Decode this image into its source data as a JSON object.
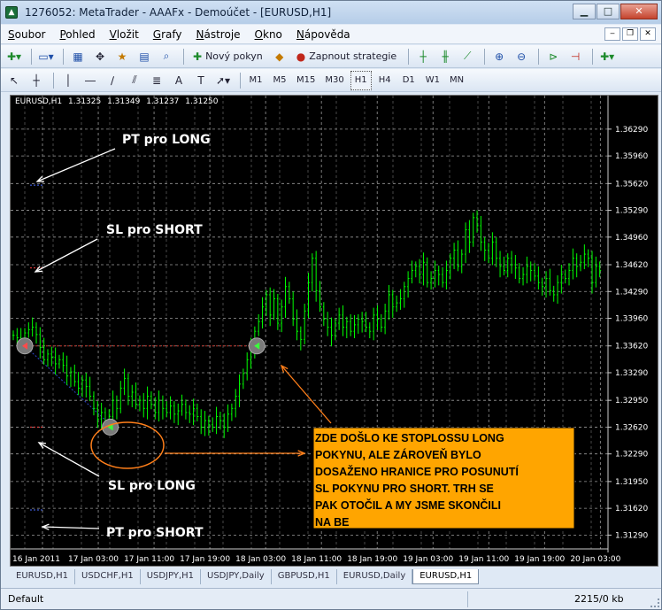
{
  "window": {
    "title": "1276052: MetaTrader - AAAFx - Demoúčet - [EURUSD,H1]",
    "minimize": "▁",
    "maximize": "□",
    "close": "✕"
  },
  "menu": {
    "items": [
      {
        "first": "S",
        "rest": "oubor"
      },
      {
        "first": "P",
        "rest": "ohled"
      },
      {
        "first": "V",
        "rest": "ložit"
      },
      {
        "first": "G",
        "rest": "rafy"
      },
      {
        "first": "N",
        "rest": "ástroje"
      },
      {
        "first": "O",
        "rest": "kno"
      },
      {
        "first": "N",
        "rest": "ápověda"
      }
    ],
    "mdi": {
      "minimize": "‒",
      "restore": "❐",
      "close": "✕"
    }
  },
  "toolbar1": {
    "new_order": "Nový pokyn",
    "strategies": "Zapnout strategie"
  },
  "toolbar2": {
    "periods": [
      "M1",
      "M5",
      "M15",
      "M30",
      "H1",
      "H4",
      "D1",
      "W1",
      "MN"
    ],
    "active_period": "H1"
  },
  "chart_data": {
    "type": "candlestick",
    "symbol_info": {
      "symbol": "EURUSD,H1",
      "open": "1.31325",
      "high": "1.31349",
      "low": "1.31237",
      "close": "1.31250"
    },
    "y_ticks": [
      "1.36290",
      "1.35960",
      "1.35620",
      "1.35290",
      "1.34960",
      "1.34620",
      "1.34290",
      "1.33960",
      "1.33620",
      "1.33290",
      "1.32950",
      "1.32620",
      "1.32290",
      "1.31950",
      "1.31620",
      "1.31290"
    ],
    "x_ticks": [
      "16 Jan 2011",
      "17 Jan 03:00",
      "17 Jan 11:00",
      "17 Jan 19:00",
      "18 Jan 03:00",
      "18 Jan 11:00",
      "18 Jan 19:00",
      "19 Jan 03:00",
      "19 Jan 11:00",
      "19 Jan 19:00",
      "20 Jan 03:00"
    ],
    "ylim": [
      1.3112,
      1.3655
    ],
    "series_close": [
      1.3375,
      1.3372,
      1.3368,
      1.3378,
      1.3382,
      1.3385,
      1.3376,
      1.336,
      1.3345,
      1.3352,
      1.3348,
      1.334,
      1.3345,
      1.3338,
      1.3325,
      1.333,
      1.3318,
      1.331,
      1.332,
      1.3312,
      1.33,
      1.3285,
      1.3272,
      1.328,
      1.3262,
      1.3275,
      1.3295,
      1.3285,
      1.331,
      1.3322,
      1.33,
      1.3305,
      1.329,
      1.3295,
      1.3285,
      1.33,
      1.329,
      1.328,
      1.3295,
      1.3285,
      1.328,
      1.3288,
      1.3278,
      1.3282,
      1.329,
      1.328,
      1.3278,
      1.3285,
      1.3275,
      1.3262,
      1.327,
      1.3265,
      1.3262,
      1.3275,
      1.327,
      1.3262,
      1.3278,
      1.3285,
      1.33,
      1.3315,
      1.3328,
      1.3345,
      1.336,
      1.338,
      1.3392,
      1.341,
      1.3425,
      1.34,
      1.342,
      1.339,
      1.341,
      1.3435,
      1.342,
      1.3395,
      1.338,
      1.337,
      1.3405,
      1.344,
      1.347,
      1.343,
      1.341,
      1.3395,
      1.3385,
      1.3375,
      1.339,
      1.34,
      1.3385,
      1.3392,
      1.338,
      1.3388,
      1.3395,
      1.3392,
      1.3385,
      1.338,
      1.34,
      1.3395,
      1.3385,
      1.3405,
      1.3425,
      1.341,
      1.3415,
      1.342,
      1.3435,
      1.3445,
      1.3455,
      1.346,
      1.345,
      1.3465,
      1.344,
      1.3445,
      1.3455,
      1.345,
      1.344,
      1.3455,
      1.347,
      1.348,
      1.346,
      1.3475,
      1.3505,
      1.349,
      1.352,
      1.351,
      1.349,
      1.348,
      1.347,
      1.349,
      1.347,
      1.346,
      1.3455,
      1.347,
      1.3462,
      1.3458,
      1.3445,
      1.345,
      1.346,
      1.3455,
      1.3448,
      1.344,
      1.3435,
      1.3445,
      1.343,
      1.3425,
      1.344,
      1.345,
      1.3445,
      1.3455,
      1.347,
      1.346,
      1.3465,
      1.3475,
      1.347,
      1.344,
      1.346,
      1.3455
    ],
    "levels": {
      "order_price": 1.3362,
      "sl_long": 1.3262,
      "pt_long": 1.356,
      "sl_short": 1.3458,
      "pt_short": 1.316
    },
    "annotations": {
      "pt_long": "PT pro LONG",
      "sl_short": "SL pro SHORT",
      "sl_long": "SL pro LONG",
      "pt_short": "PT pro SHORT",
      "note_lines": [
        "ZDE DOŠLO KE STOPLOSSU LONG",
        "POKYNU, ALE ZÁROVEŇ BYLO",
        "DOSAŽENO HRANICE PRO POSUNUTÍ",
        "SL POKYNU PRO SHORT. TRH SE",
        "PAK OTOČIL A MY JSME SKONČILI",
        "NA BE"
      ]
    },
    "colors": {
      "background": "#000000",
      "candle": "#00ff00",
      "grid": "#aaaaaa",
      "arrow_white": "#ffffff",
      "arrow_orange": "#ff7f1a",
      "note_bg": "#ffa500"
    }
  },
  "tabs": [
    "EURUSD,H1",
    "USDCHF,H1",
    "USDJPY,H1",
    "USDJPY,Daily",
    "GBPUSD,H1",
    "EURUSD,Daily",
    "EURUSD,H1"
  ],
  "active_tab": 6,
  "status": {
    "left": "Default",
    "right": "2215/0 kb"
  }
}
